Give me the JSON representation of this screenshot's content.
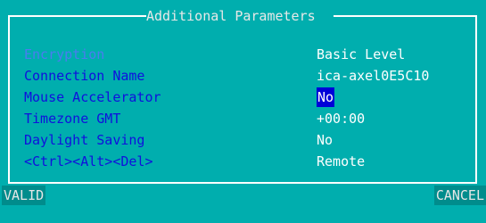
{
  "dialog": {
    "title": "Additional Parameters"
  },
  "params": [
    {
      "label": "Encryption",
      "value": "Basic Level",
      "disabled": true
    },
    {
      "label": "Connection Name",
      "value": "ica-axel0E5C10"
    },
    {
      "label": "Mouse Accelerator",
      "value": "No",
      "selected": true
    },
    {
      "label": "Timezone GMT",
      "value": "+00:00"
    },
    {
      "label": "Daylight Saving",
      "value": "No"
    },
    {
      "label": "<Ctrl><Alt><Del>",
      "value": "Remote"
    }
  ],
  "buttons": {
    "valid": "VALID",
    "cancel": "CANCEL"
  },
  "colors": {
    "background": "#00aeae",
    "label": "#1010dd",
    "label_disabled": "#4a7cf0",
    "value": "#ffffff",
    "selection": "#0000d8"
  }
}
